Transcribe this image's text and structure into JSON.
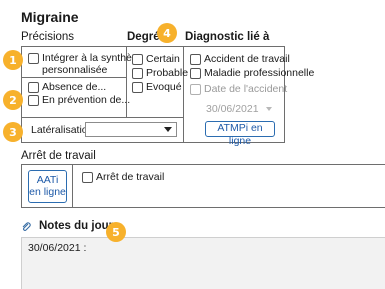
{
  "page_title": "Migraine",
  "sections": {
    "precisions": "Précisions",
    "degre": "Degré",
    "diagnostic": "Diagnostic lié à",
    "arret": "Arrêt de travail",
    "notes": "Notes du jour"
  },
  "precisions": {
    "synthese_line1": "Intégrer à la synthèse",
    "synthese_line2": "personnalisée",
    "absence": "Absence de...",
    "prevention": "En prévention de...",
    "lateralisation_label": "Latéralisation",
    "lateralisation_value": ""
  },
  "degre": {
    "options": [
      "Certain",
      "Probable",
      "Evoqué"
    ]
  },
  "diagnostic": {
    "accident": "Accident de travail",
    "maladie": "Maladie professionnelle",
    "date_label": "Date de l'accident",
    "date_value": "30/06/2021",
    "atmpi_button": "ATMPi en ligne"
  },
  "arret": {
    "aati_line1": "AATi",
    "aati_line2": "en ligne",
    "checkbox_label": "Arrêt de travail"
  },
  "notes": {
    "content": "30/06/2021 :"
  },
  "badges": [
    "1",
    "2",
    "3",
    "4",
    "5"
  ],
  "colors": {
    "badge": "#f7b12c",
    "button_border": "#2b6cb0",
    "box_border": "#6e6e6e"
  }
}
